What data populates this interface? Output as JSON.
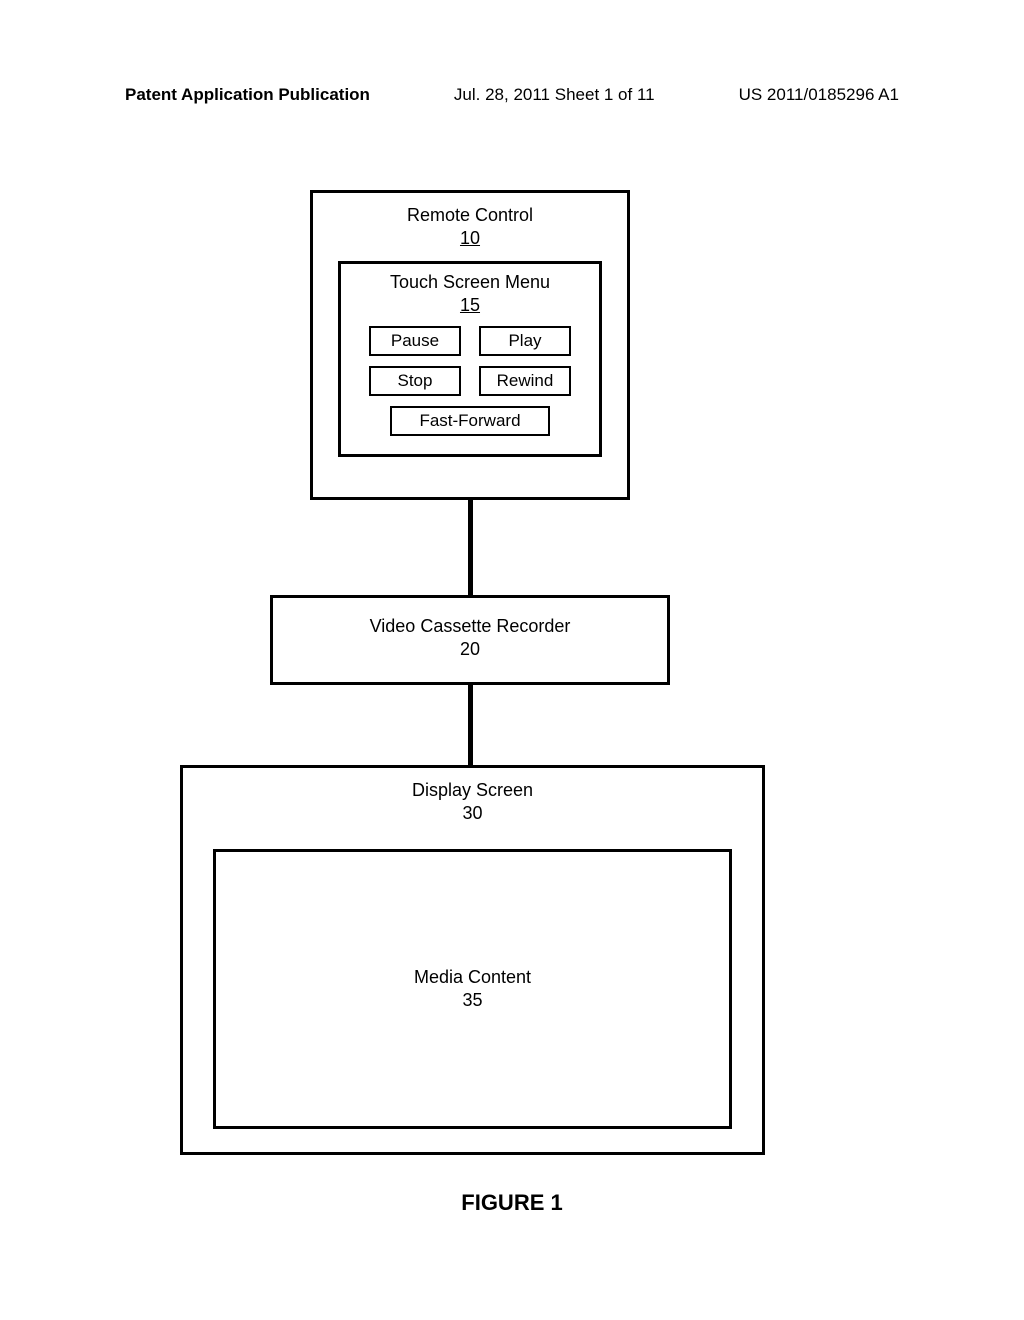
{
  "header": {
    "left": "Patent Application Publication",
    "center": "Jul. 28, 2011  Sheet 1 of 11",
    "right": "US 2011/0185296 A1"
  },
  "remote_control": {
    "title": "Remote Control",
    "num": "10"
  },
  "touch_menu": {
    "title": "Touch Screen Menu",
    "num": "15",
    "buttons": {
      "pause": "Pause",
      "play": "Play",
      "stop": "Stop",
      "rewind": "Rewind",
      "fastforward": "Fast-Forward"
    }
  },
  "vcr": {
    "title": "Video Cassette Recorder",
    "num": "20"
  },
  "display": {
    "title": "Display Screen",
    "num": "30"
  },
  "media": {
    "title": "Media Content",
    "num": "35"
  },
  "figure_label": "FIGURE 1"
}
